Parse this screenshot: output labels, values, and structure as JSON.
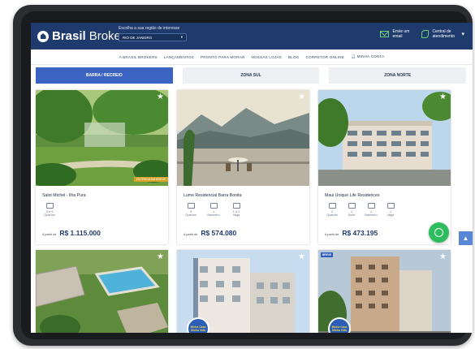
{
  "brand": {
    "bold": "Brasil",
    "light": "Brokers"
  },
  "header": {
    "region_label": "Escolha a sua região de interesse",
    "region_value": "RIO DE JANEIRO",
    "email_label": "Envie um email",
    "support_label": "Central de atendimento"
  },
  "nav": [
    "A BRASIL BROKERS",
    "LANÇAMENTOS",
    "PRONTO PARA MORAR",
    "NOSSAS LOJAS",
    "BLOG",
    "CORRETOR ONLINE",
    "MINHA CONTA"
  ],
  "tabs": [
    {
      "label": "BARRA / RECREIO",
      "active": true
    },
    {
      "label": "ZONA SUL",
      "active": false
    },
    {
      "label": "ZONA NORTE",
      "active": false
    }
  ],
  "cards": [
    {
      "title": "Saint Michel - Ilha Pura",
      "ribbon": "ENTREGA EM BREVE",
      "specs": [
        {
          "value": "3 e 4",
          "label": "Quartos"
        }
      ],
      "price_prefix": "A partir de",
      "price": "R$ 1.115.000"
    },
    {
      "title": "Lume Residencial Barra Bonita",
      "specs": [
        {
          "value": "3",
          "label": "Quartos"
        },
        {
          "value": "1",
          "label": "Banheiro"
        },
        {
          "value": "1 a 2",
          "label": "Vaga"
        }
      ],
      "price_prefix": "A partir de",
      "price": "R$ 574.080"
    },
    {
      "title": "Maui Unique Life Residences",
      "specs": [
        {
          "value": "2",
          "label": "Quartos"
        },
        {
          "value": "1",
          "label": "Suíte"
        },
        {
          "value": "1",
          "label": "Banheiro"
        },
        {
          "value": "1",
          "label": "Vaga"
        }
      ],
      "price_prefix": "A partir de",
      "price": "R$ 473.195"
    }
  ],
  "bottom_cards": [
    {
      "badge": ""
    },
    {
      "badge": "Minha Casa Minha Vida"
    },
    {
      "badge": "Minha Casa Minha Vida",
      "top_badge": "BREVE"
    }
  ],
  "colors": {
    "header": "#1f3a6d",
    "tab_active": "#3b63c1",
    "whatsapp": "#2dbd5e",
    "price": "#1f3a6d"
  }
}
